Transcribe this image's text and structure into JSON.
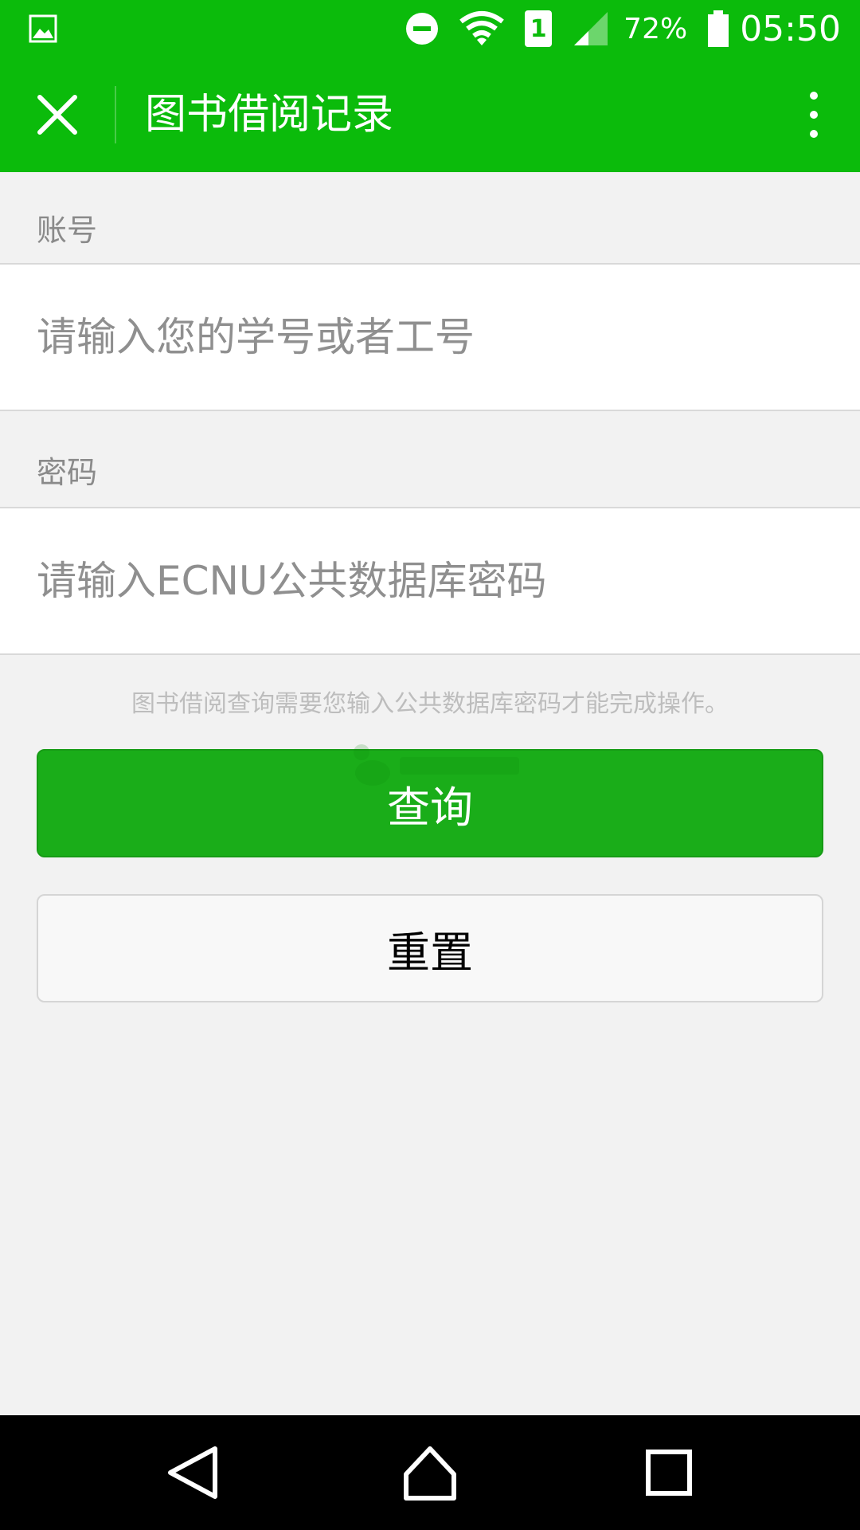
{
  "status_bar": {
    "battery_percent": "72%",
    "time": "05:50",
    "sim_badge": "1",
    "icons": [
      "image-icon",
      "dnd-icon",
      "wifi-icon",
      "sim-icon",
      "signal-icon",
      "battery-icon"
    ]
  },
  "header": {
    "title": "图书借阅记录",
    "close_icon": "close-icon",
    "more_icon": "more-vertical-icon"
  },
  "account": {
    "label": "账号",
    "placeholder": "请输入您的学号或者工号",
    "value": ""
  },
  "password": {
    "label": "密码",
    "placeholder": "请输入ECNU公共数据库密码",
    "value": ""
  },
  "hint": "图书借阅查询需要您输入公共数据库密码才能完成操作。",
  "buttons": {
    "query": "查询",
    "reset": "重置"
  },
  "colors": {
    "brand_green": "#0bbb0b",
    "button_green": "#1aad19",
    "background": "#f2f2f2"
  },
  "nav_bar": {
    "icons": [
      "back-icon",
      "home-icon",
      "recents-icon"
    ]
  }
}
